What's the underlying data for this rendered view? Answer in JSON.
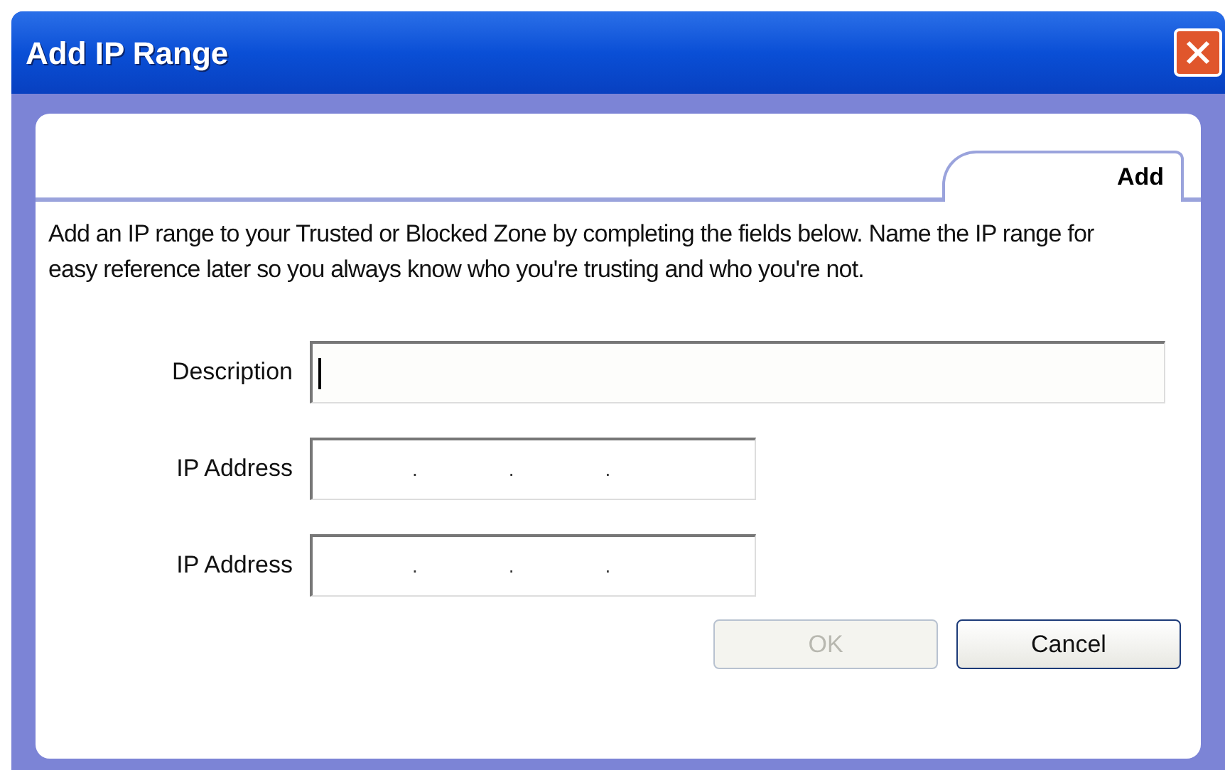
{
  "window": {
    "title": "Add IP Range"
  },
  "tabs": [
    {
      "label": "Add",
      "selected": true
    }
  ],
  "intro": "Add an IP range to your Trusted or Blocked Zone by completing the fields below. Name the IP range for easy reference later so you always know who you're trusting and who you're not.",
  "fields": [
    {
      "kind": "text",
      "label": "Description",
      "focused": true
    },
    {
      "kind": "ip",
      "label": "IP Address",
      "separators": [
        ".",
        ".",
        "."
      ]
    },
    {
      "kind": "ip",
      "label": "IP Address",
      "separators": [
        ".",
        ".",
        "."
      ]
    }
  ],
  "buttons": [
    {
      "label": "OK",
      "disabled": true
    },
    {
      "label": "Cancel",
      "disabled": false
    }
  ]
}
